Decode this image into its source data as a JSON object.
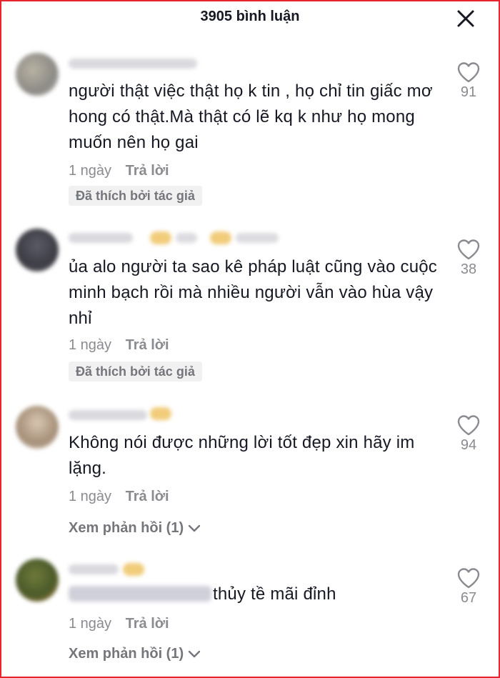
{
  "header": {
    "title": "3905 bình luận"
  },
  "comments": [
    {
      "text": "người thật việc thật họ k tin , họ chỉ tin giấc mơ hong có thật.Mà thật có lẽ kq k như họ mong muốn nên họ gai",
      "time": "1 ngày",
      "reply": "Trả lời",
      "author_liked": "Đã thích bởi tác giả",
      "likes": "91"
    },
    {
      "text": "ủa alo người ta sao kê pháp luật cũng vào cuộc minh bạch rồi mà nhiều người vẫn vào hùa vậy nhỉ",
      "time": "1 ngày",
      "reply": "Trả lời",
      "author_liked": "Đã thích bởi tác giả",
      "likes": "38"
    },
    {
      "text": "Không nói được những lời tốt đẹp xin hãy im lặng.",
      "time": "1 ngày",
      "reply": "Trả lời",
      "view_replies": "Xem phản hồi (1)",
      "likes": "94"
    },
    {
      "text": "thủy tề mãi đỉnh",
      "time": "1 ngày",
      "reply": "Trả lời",
      "view_replies": "Xem phản hồi (1)",
      "likes": "67"
    }
  ],
  "icons": {
    "close": "close-icon",
    "like": "heart-outline-icon",
    "expand": "chevron-down-icon"
  },
  "colors": {
    "text": "#161823",
    "secondary": "#8a8b91",
    "badge_bg": "#f1f1f2",
    "frame_border": "#e8252f"
  }
}
